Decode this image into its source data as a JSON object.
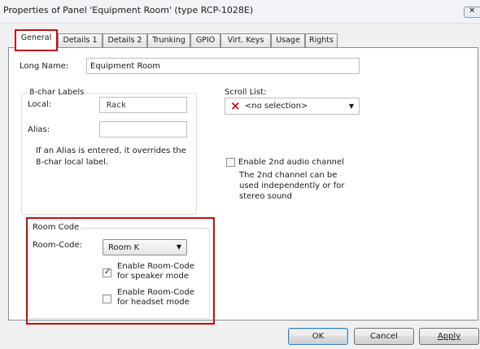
{
  "window": {
    "title": "Properties of Panel 'Equipment Room' (type RCP-1028E)",
    "close_glyph": "✕"
  },
  "tabs": [
    {
      "label": "General",
      "active": true
    },
    {
      "label": "Details 1"
    },
    {
      "label": "Details 2"
    },
    {
      "label": "Trunking"
    },
    {
      "label": "GPIO"
    },
    {
      "label": "Virt. Keys"
    },
    {
      "label": "Usage"
    },
    {
      "label": "Rights"
    }
  ],
  "general": {
    "long_name_label": "Long Name:",
    "long_name_value": "Equipment Room",
    "labels_group_title": "8-char Labels",
    "local_label": "Local:",
    "local_value": "Rack",
    "alias_label": "Alias:",
    "alias_value": "",
    "alias_hint_line1": "If an Alias is entered, it overrides the",
    "alias_hint_line2": "8-char local label.",
    "scroll_list_label": "Scroll List:",
    "scroll_list_icon": "×",
    "scroll_list_value": "<no selection>",
    "enable_2nd_audio_label": "Enable 2nd audio channel",
    "enable_2nd_audio_checked": false,
    "audio_hint_line1": "The 2nd channel can be",
    "audio_hint_line2": "used independently or for",
    "audio_hint_line3": "stereo sound"
  },
  "room_code": {
    "group_title": "Room Code",
    "label": "Room-Code:",
    "value": "Room K",
    "speaker_label_line1": "Enable Room-Code",
    "speaker_label_line2": "for speaker mode",
    "speaker_checked": true,
    "headset_label_line1": "Enable Room-Code",
    "headset_label_line2": "for headset mode",
    "headset_checked": false
  },
  "buttons": {
    "ok": "OK",
    "cancel": "Cancel",
    "apply": "Apply"
  },
  "colors": {
    "highlight": "#c01010",
    "scroll_list_icon": "#c4141c"
  }
}
